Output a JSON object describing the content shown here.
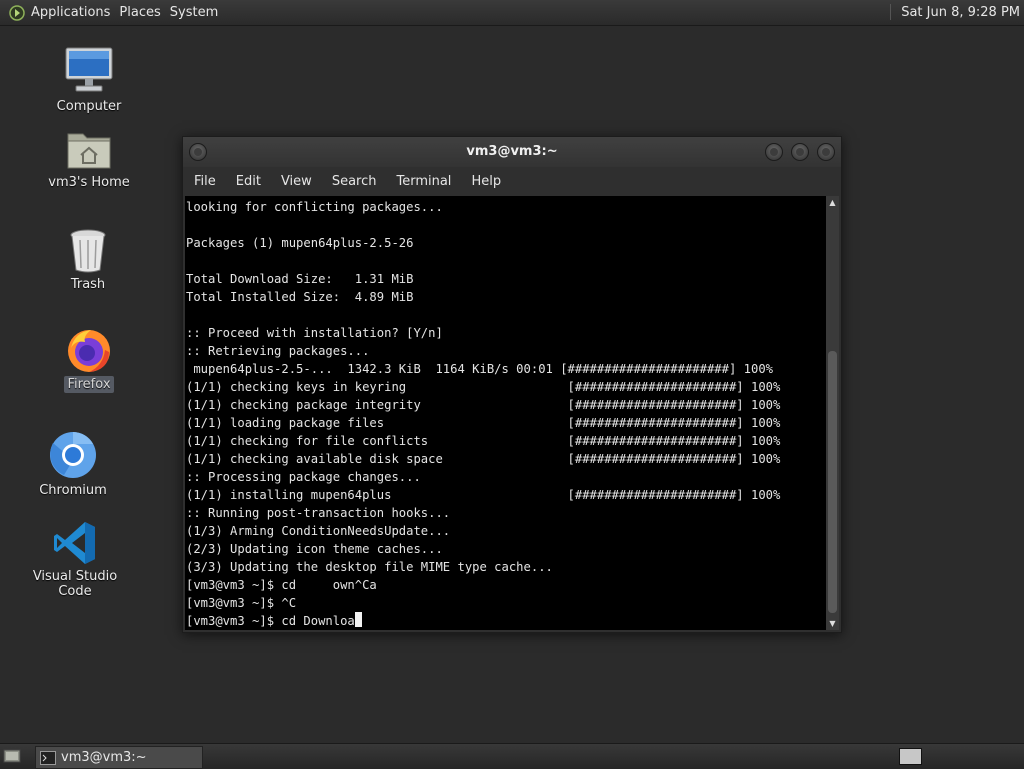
{
  "top_panel": {
    "menus": [
      "Applications",
      "Places",
      "System"
    ],
    "clock": "Sat Jun  8,  9:28 PM"
  },
  "desktop_icons": {
    "computer": "Computer",
    "home": "vm3's Home",
    "trash": "Trash",
    "firefox": "Firefox",
    "chromium": "Chromium",
    "vscode": "Visual Studio Code"
  },
  "window": {
    "title": "vm3@vm3:~",
    "menu": [
      "File",
      "Edit",
      "View",
      "Search",
      "Terminal",
      "Help"
    ],
    "terminal_lines": [
      "looking for conflicting packages...",
      "",
      "Packages (1) mupen64plus-2.5-26",
      "",
      "Total Download Size:   1.31 MiB",
      "Total Installed Size:  4.89 MiB",
      "",
      ":: Proceed with installation? [Y/n]",
      ":: Retrieving packages...",
      " mupen64plus-2.5-...  1342.3 KiB  1164 KiB/s 00:01 [######################] 100%",
      "(1/1) checking keys in keyring                      [######################] 100%",
      "(1/1) checking package integrity                    [######################] 100%",
      "(1/1) loading package files                         [######################] 100%",
      "(1/1) checking for file conflicts                   [######################] 100%",
      "(1/1) checking available disk space                 [######################] 100%",
      ":: Processing package changes...",
      "(1/1) installing mupen64plus                        [######################] 100%",
      ":: Running post-transaction hooks...",
      "(1/3) Arming ConditionNeedsUpdate...",
      "(2/3) Updating icon theme caches...",
      "(3/3) Updating the desktop file MIME type cache...",
      "[vm3@vm3 ~]$ cd     own^Ca",
      "[vm3@vm3 ~]$ ^C"
    ],
    "prompt_line": "[vm3@vm3 ~]$ cd Downloa"
  },
  "bottom_panel": {
    "task_label": "vm3@vm3:~"
  },
  "colors": {
    "desktop_bg": "#2b2b2b",
    "terminal_bg": "#000000",
    "terminal_fg": "#e4e4e4"
  }
}
